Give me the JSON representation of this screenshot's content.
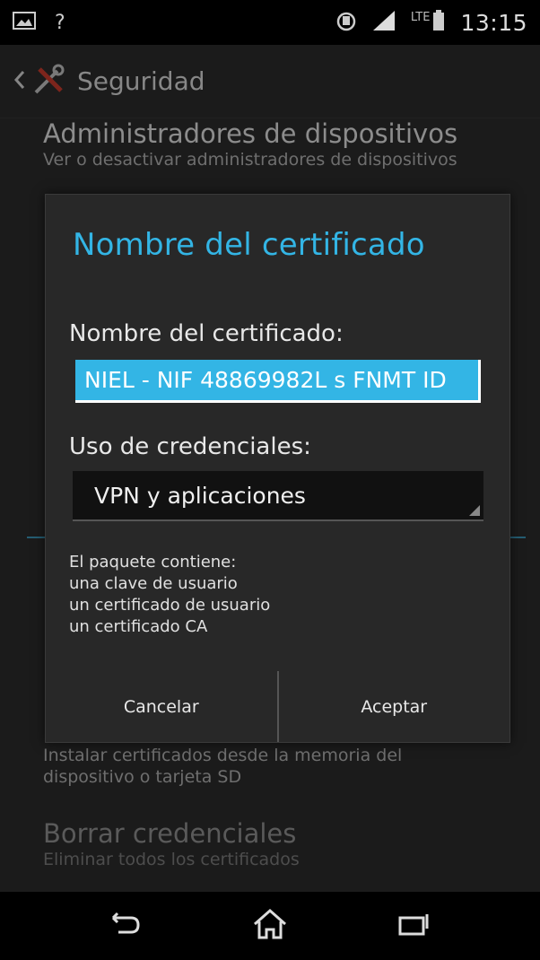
{
  "status_bar": {
    "network_label": "LTE",
    "time": "13:15",
    "icons": [
      "gallery-icon",
      "wifi-question-icon",
      "alarm-icon",
      "signal-icon",
      "battery-icon"
    ]
  },
  "settings": {
    "title": "Seguridad",
    "items": [
      {
        "title": "Administradores de dispositivos",
        "summary": "Ver o desactivar administradores de dispositivos"
      },
      {
        "title": "",
        "summary": "Instalar certificados desde la memoria del dispositivo o tarjeta SD"
      },
      {
        "title": "Borrar credenciales",
        "summary": "Eliminar todos los certificados"
      }
    ]
  },
  "dialog": {
    "title": "Nombre del certificado",
    "cert_label": "Nombre del certificado:",
    "cert_value": "NIEL - NIF 48869982L s FNMT ID",
    "cred_label": "Uso de credenciales:",
    "cred_selected": "VPN y aplicaciones",
    "package_lines": [
      "El paquete contiene:",
      "una clave de usuario",
      "un certificado de usuario",
      "un certificado CA"
    ],
    "cancel_label": "Cancelar",
    "accept_label": "Aceptar"
  },
  "colors": {
    "accent": "#33b5e5",
    "dialog_bg": "#282828"
  }
}
